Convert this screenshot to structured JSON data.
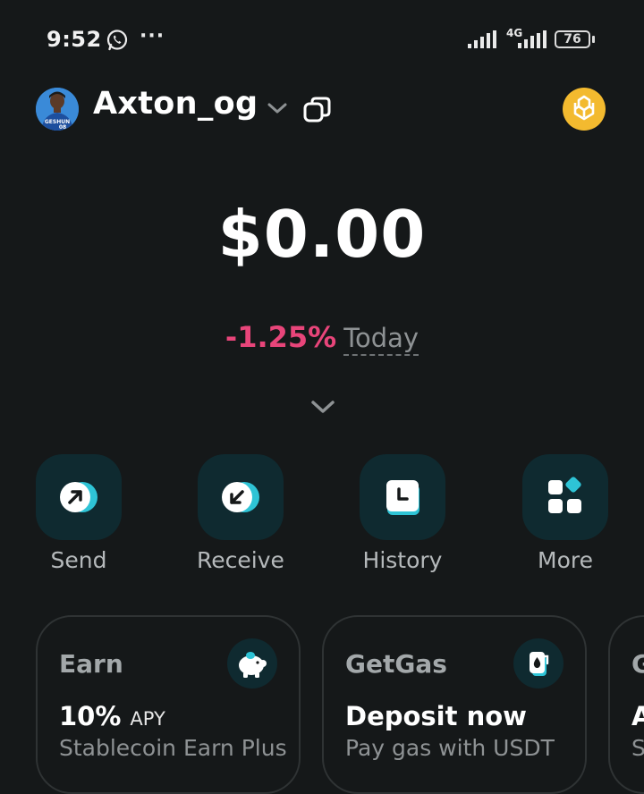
{
  "status_bar": {
    "time": "9:52",
    "more_indicator": "···",
    "network": "4G",
    "battery": "76"
  },
  "header": {
    "username": "Axton_og",
    "avatar_jersey_text": "GESHUN",
    "avatar_jersey_number": "08"
  },
  "balance": {
    "amount": "$0.00",
    "change_percent": "-1.25%",
    "change_period": "Today"
  },
  "actions": [
    {
      "label": "Send",
      "icon": "send-arrow-icon"
    },
    {
      "label": "Receive",
      "icon": "receive-arrow-icon"
    },
    {
      "label": "History",
      "icon": "history-icon"
    },
    {
      "label": "More",
      "icon": "grid-icon"
    }
  ],
  "cards": [
    {
      "title": "Earn",
      "main": "10%",
      "main_suffix": "APY",
      "sub": "Stablecoin Earn Plus",
      "icon": "piggy-bank-icon"
    },
    {
      "title": "GetGas",
      "main": "Deposit now",
      "sub": "Pay gas with USDT",
      "icon": "fuel-icon"
    },
    {
      "title": "G",
      "main": "A",
      "sub": "S"
    }
  ],
  "colors": {
    "background": "#151819",
    "accent_teal": "#2ec4d6",
    "negative": "#e8457a",
    "bnb_yellow": "#f3ba2f",
    "action_bg": "#0f2a30"
  }
}
